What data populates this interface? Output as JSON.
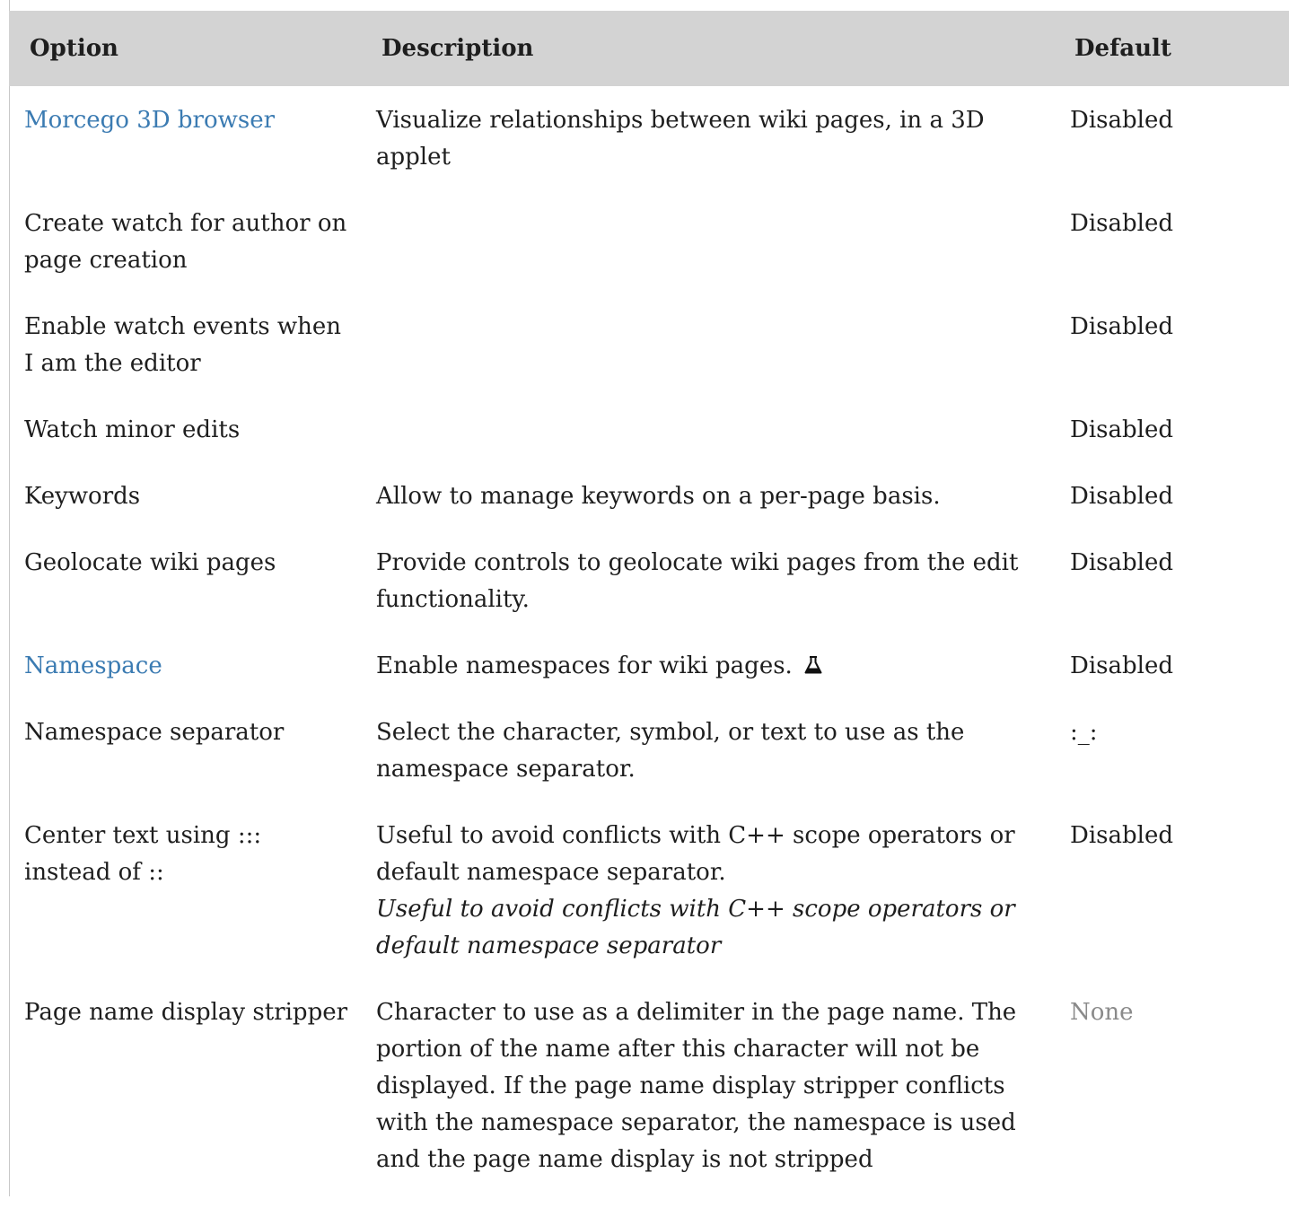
{
  "table": {
    "headers": {
      "option": "Option",
      "description": "Description",
      "default": "Default"
    },
    "rows": [
      {
        "option": "Morcego 3D browser",
        "option_is_link": true,
        "description": "Visualize relationships between wiki pages, in a 3D applet",
        "default": "Disabled"
      },
      {
        "option": "Create watch for author on page creation",
        "description": "",
        "default": "Disabled"
      },
      {
        "option": "Enable watch events when I am the editor",
        "description": "",
        "default": "Disabled"
      },
      {
        "option": "Watch minor edits",
        "description": "",
        "default": "Disabled"
      },
      {
        "option": "Keywords",
        "description": "Allow to manage keywords on a per-page basis.",
        "default": "Disabled"
      },
      {
        "option": "Geolocate wiki pages",
        "description": "Provide controls to geolocate wiki pages from the edit functionality.",
        "default": "Disabled"
      },
      {
        "option": "Namespace",
        "option_is_link": true,
        "description": "Enable namespaces for wiki pages.",
        "description_icon": "flask-icon",
        "default": "Disabled"
      },
      {
        "option": "Namespace separator",
        "description": "Select the character, symbol, or text to use as the namespace separator.",
        "default": ":_:"
      },
      {
        "option": "Center text using ::: instead of ::",
        "description": "Useful to avoid conflicts with C++ scope operators or default namespace separator.",
        "description_note": "Useful to avoid conflicts with C++ scope operators or default namespace separator",
        "default": "Disabled"
      },
      {
        "option": "Page name display stripper",
        "description": "Character to use as a delimiter in the page name. The portion of the name after this character will not be displayed. If the page name display stripper conflicts with the namespace separator, the namespace is used and the page name display is not stripped",
        "default": "None",
        "default_muted": true
      }
    ]
  },
  "colors": {
    "header_bg": "#d3d3d3",
    "link": "#3b7bb2",
    "text": "#1e1e1e",
    "muted": "#8a8a8a"
  }
}
